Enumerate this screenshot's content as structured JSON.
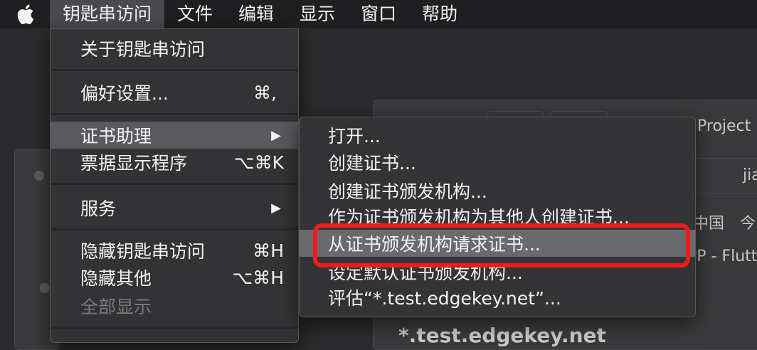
{
  "menubar": {
    "apple": "apple-logo-icon",
    "items": [
      {
        "label": "钥匙串访问",
        "active": true
      },
      {
        "label": "文件"
      },
      {
        "label": "编辑"
      },
      {
        "label": "显示"
      },
      {
        "label": "窗口"
      },
      {
        "label": "帮助"
      }
    ]
  },
  "main_menu": {
    "about": "关于钥匙串访问",
    "prefs": {
      "label": "偏好设置...",
      "shortcut": "⌘,"
    },
    "cert_assistant": {
      "label": "证书助理",
      "arrow": "▶"
    },
    "ticket_viewer": {
      "label": "票据显示程序",
      "shortcut": "⌥⌘K"
    },
    "services": {
      "label": "服务",
      "arrow": "▶"
    },
    "hide": {
      "label": "隐藏钥匙串访问",
      "shortcut": "⌘H"
    },
    "hide_others": {
      "label": "隐藏其他",
      "shortcut": "⌥⌘H"
    },
    "show_all": "全部显示"
  },
  "sub_menu": {
    "items": [
      "打开...",
      "创建证书...",
      "创建证书颁发机构...",
      "作为证书颁发机构为其他人创建证书...",
      "从证书颁发机构请求证书...",
      "设定默认证书颁发机构...",
      "评估“*.test.edgekey.net”..."
    ]
  },
  "background": {
    "project_text": "Project",
    "url_text": "jia",
    "tab_text1": "中国",
    "tab_text2": "今",
    "title_text": "PP - Flutt",
    "bottom_text": "*.test.edgekey.net"
  },
  "colors": {
    "highlight": "#ef1c1c",
    "menubar": "#1f1f21",
    "menu": "#343436"
  }
}
